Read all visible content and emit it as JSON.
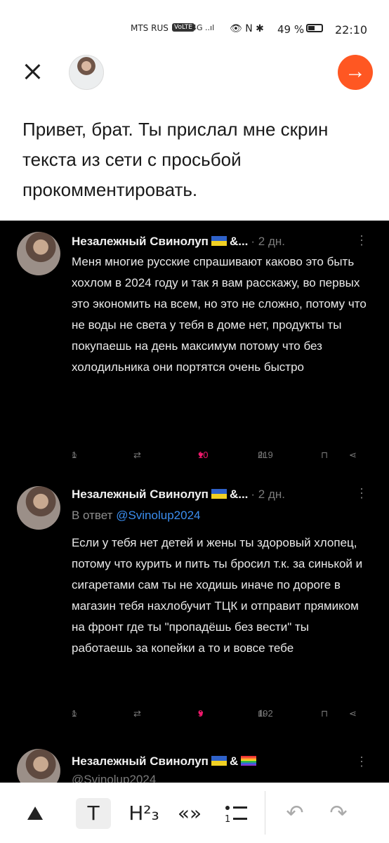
{
  "status_bar": {
    "carrier": "MTS RUS",
    "volte": "VoLTE",
    "network": "4G ..ıl",
    "icons": "👁 N ✱",
    "battery": "49 %",
    "time": "22:10"
  },
  "top_bar": {
    "close_icon": "×",
    "send_icon": "→"
  },
  "message": {
    "text": "Привет, брат. Ты прислал мне скрин текста из сети с просьбой прокомментировать."
  },
  "tweets": [
    {
      "author": "Незалежный Свинолуп",
      "author_suffix": "&...",
      "time": "· 2 дн.",
      "more": "⋮",
      "text": "Меня многие русские спрашивают каково это быть хохлом в 2024 году и так я вам расскажу, во первых это экономить на всем, но это не сложно, потому что не воды не света у тебя в доме нет, продукты ты покупаешь на день максимум потому что без холодильника они портятся очень быстро",
      "replies": "1",
      "likes": "10",
      "views": "219"
    },
    {
      "author": "Незалежный Свинолуп",
      "author_suffix": "&...",
      "time": "· 2 дн.",
      "more": "⋮",
      "reply_prefix": "В ответ",
      "reply_handle": "@Svinolup2024",
      "text": "Если у тебя нет детей и жены ты здоровый хлопец, потому что курить и пить ты бросил т.к. за синькой и сигаретами сам ты не ходишь иначе по дороге в магазин тебя нахлобучит ТЦК и отправит прямиком на фронт где ты \"пропадёшь без вести\" ты работаешь за копейки а то и вовсе тебе",
      "replies": "1",
      "likes": "9",
      "views": "192"
    },
    {
      "author": "Незалежный Свинолуп",
      "author_suffix": "&",
      "more": "⋮",
      "handle": "@Svinolup2024"
    }
  ],
  "icons": {
    "reply": "○",
    "retweet": "⇄",
    "heart": "♥",
    "views": "ılı",
    "bookmark": "⊓",
    "share": "⋖"
  },
  "toolbar": {
    "image": "⛰",
    "text": "T",
    "heading": "H²₃",
    "quote": "«»",
    "list": "•―\n1―",
    "undo": "↶",
    "redo": "↷"
  }
}
